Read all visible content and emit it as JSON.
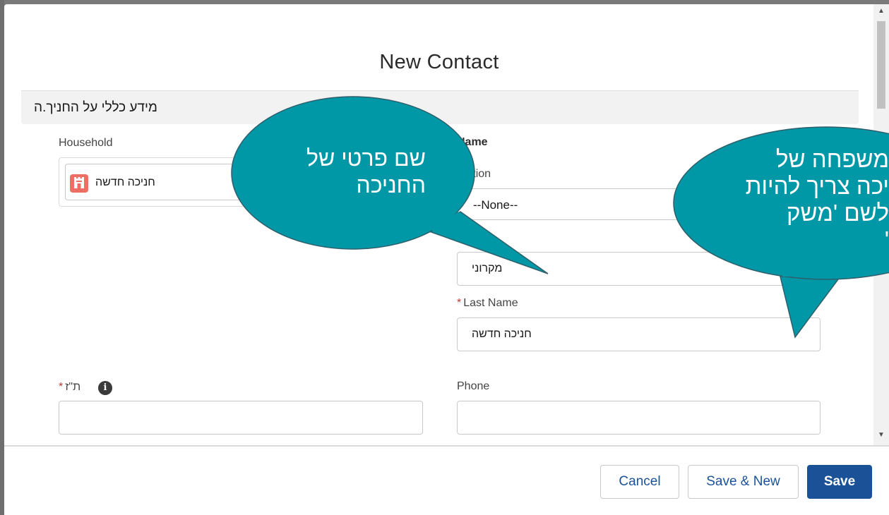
{
  "modal": {
    "title": "New Contact"
  },
  "section": {
    "title": "מידע כללי על החניך.ה"
  },
  "household": {
    "label": "Household",
    "value": "חניכה חדשה",
    "icon": "household-castle-icon",
    "icon_color": "#ef6e64"
  },
  "name": {
    "heading": "Name",
    "salutation_label": "utation",
    "salutation_value": "--None--",
    "first_name_label": "me",
    "first_name_value": "מקרוני",
    "last_name_label": "Last Name",
    "last_name_value": "חניכה חדשה",
    "required_mark": "*"
  },
  "id_field": {
    "label": "ת\"ז",
    "value": "",
    "required_mark": "*",
    "icon": "info-icon",
    "icon_glyph": "i"
  },
  "phone": {
    "label": "Phone",
    "value": ""
  },
  "footer": {
    "cancel": "Cancel",
    "save_new": "Save & New",
    "save": "Save"
  },
  "callouts": {
    "left": [
      "שם פרטי של",
      "החניכה"
    ],
    "right": [
      "משפחה של",
      "יכה צריך להיות",
      "לשם 'משק",
      "'"
    ]
  },
  "colors": {
    "accent": "#1b5297",
    "callout": "#0097a7",
    "required": "#c23934"
  }
}
